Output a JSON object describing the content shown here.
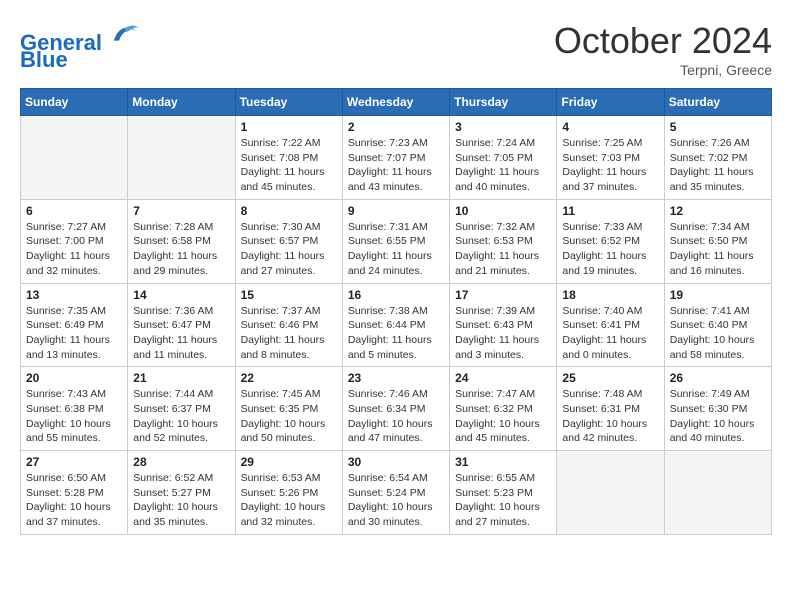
{
  "header": {
    "logo_line1": "General",
    "logo_line2": "Blue",
    "month_title": "October 2024",
    "location": "Terpni, Greece"
  },
  "weekdays": [
    "Sunday",
    "Monday",
    "Tuesday",
    "Wednesday",
    "Thursday",
    "Friday",
    "Saturday"
  ],
  "weeks": [
    [
      {
        "day": "",
        "info": ""
      },
      {
        "day": "",
        "info": ""
      },
      {
        "day": "1",
        "info": "Sunrise: 7:22 AM\nSunset: 7:08 PM\nDaylight: 11 hours and 45 minutes."
      },
      {
        "day": "2",
        "info": "Sunrise: 7:23 AM\nSunset: 7:07 PM\nDaylight: 11 hours and 43 minutes."
      },
      {
        "day": "3",
        "info": "Sunrise: 7:24 AM\nSunset: 7:05 PM\nDaylight: 11 hours and 40 minutes."
      },
      {
        "day": "4",
        "info": "Sunrise: 7:25 AM\nSunset: 7:03 PM\nDaylight: 11 hours and 37 minutes."
      },
      {
        "day": "5",
        "info": "Sunrise: 7:26 AM\nSunset: 7:02 PM\nDaylight: 11 hours and 35 minutes."
      }
    ],
    [
      {
        "day": "6",
        "info": "Sunrise: 7:27 AM\nSunset: 7:00 PM\nDaylight: 11 hours and 32 minutes."
      },
      {
        "day": "7",
        "info": "Sunrise: 7:28 AM\nSunset: 6:58 PM\nDaylight: 11 hours and 29 minutes."
      },
      {
        "day": "8",
        "info": "Sunrise: 7:30 AM\nSunset: 6:57 PM\nDaylight: 11 hours and 27 minutes."
      },
      {
        "day": "9",
        "info": "Sunrise: 7:31 AM\nSunset: 6:55 PM\nDaylight: 11 hours and 24 minutes."
      },
      {
        "day": "10",
        "info": "Sunrise: 7:32 AM\nSunset: 6:53 PM\nDaylight: 11 hours and 21 minutes."
      },
      {
        "day": "11",
        "info": "Sunrise: 7:33 AM\nSunset: 6:52 PM\nDaylight: 11 hours and 19 minutes."
      },
      {
        "day": "12",
        "info": "Sunrise: 7:34 AM\nSunset: 6:50 PM\nDaylight: 11 hours and 16 minutes."
      }
    ],
    [
      {
        "day": "13",
        "info": "Sunrise: 7:35 AM\nSunset: 6:49 PM\nDaylight: 11 hours and 13 minutes."
      },
      {
        "day": "14",
        "info": "Sunrise: 7:36 AM\nSunset: 6:47 PM\nDaylight: 11 hours and 11 minutes."
      },
      {
        "day": "15",
        "info": "Sunrise: 7:37 AM\nSunset: 6:46 PM\nDaylight: 11 hours and 8 minutes."
      },
      {
        "day": "16",
        "info": "Sunrise: 7:38 AM\nSunset: 6:44 PM\nDaylight: 11 hours and 5 minutes."
      },
      {
        "day": "17",
        "info": "Sunrise: 7:39 AM\nSunset: 6:43 PM\nDaylight: 11 hours and 3 minutes."
      },
      {
        "day": "18",
        "info": "Sunrise: 7:40 AM\nSunset: 6:41 PM\nDaylight: 11 hours and 0 minutes."
      },
      {
        "day": "19",
        "info": "Sunrise: 7:41 AM\nSunset: 6:40 PM\nDaylight: 10 hours and 58 minutes."
      }
    ],
    [
      {
        "day": "20",
        "info": "Sunrise: 7:43 AM\nSunset: 6:38 PM\nDaylight: 10 hours and 55 minutes."
      },
      {
        "day": "21",
        "info": "Sunrise: 7:44 AM\nSunset: 6:37 PM\nDaylight: 10 hours and 52 minutes."
      },
      {
        "day": "22",
        "info": "Sunrise: 7:45 AM\nSunset: 6:35 PM\nDaylight: 10 hours and 50 minutes."
      },
      {
        "day": "23",
        "info": "Sunrise: 7:46 AM\nSunset: 6:34 PM\nDaylight: 10 hours and 47 minutes."
      },
      {
        "day": "24",
        "info": "Sunrise: 7:47 AM\nSunset: 6:32 PM\nDaylight: 10 hours and 45 minutes."
      },
      {
        "day": "25",
        "info": "Sunrise: 7:48 AM\nSunset: 6:31 PM\nDaylight: 10 hours and 42 minutes."
      },
      {
        "day": "26",
        "info": "Sunrise: 7:49 AM\nSunset: 6:30 PM\nDaylight: 10 hours and 40 minutes."
      }
    ],
    [
      {
        "day": "27",
        "info": "Sunrise: 6:50 AM\nSunset: 5:28 PM\nDaylight: 10 hours and 37 minutes."
      },
      {
        "day": "28",
        "info": "Sunrise: 6:52 AM\nSunset: 5:27 PM\nDaylight: 10 hours and 35 minutes."
      },
      {
        "day": "29",
        "info": "Sunrise: 6:53 AM\nSunset: 5:26 PM\nDaylight: 10 hours and 32 minutes."
      },
      {
        "day": "30",
        "info": "Sunrise: 6:54 AM\nSunset: 5:24 PM\nDaylight: 10 hours and 30 minutes."
      },
      {
        "day": "31",
        "info": "Sunrise: 6:55 AM\nSunset: 5:23 PM\nDaylight: 10 hours and 27 minutes."
      },
      {
        "day": "",
        "info": ""
      },
      {
        "day": "",
        "info": ""
      }
    ]
  ]
}
